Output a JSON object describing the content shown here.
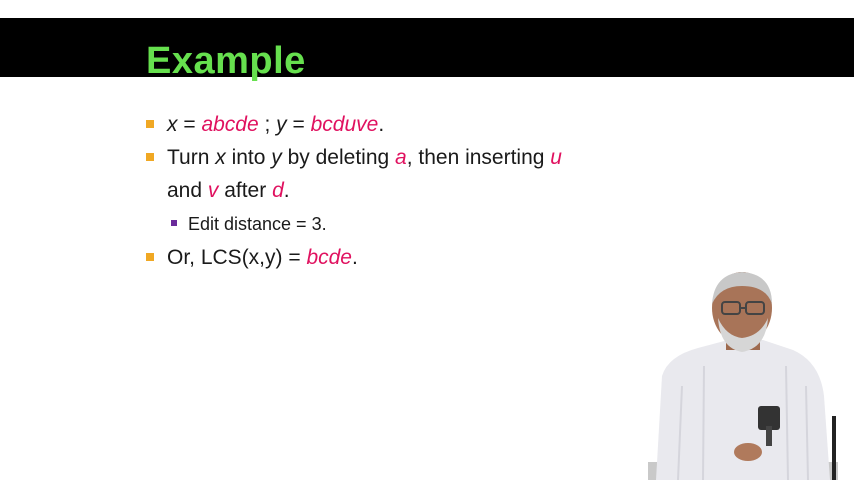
{
  "slide": {
    "title": "Example",
    "bullets": {
      "b1": {
        "x": "x",
        "eq1": " = ",
        "abcde": "abcde",
        "sep": " ; ",
        "y": "y",
        "eq2": " = ",
        "bcduve": "bcduve",
        "dot": "."
      },
      "b2": {
        "turn": "Turn ",
        "x": "x",
        "into": "  into ",
        "y": "y",
        "by": "  by deleting ",
        "a": "a",
        "then": ", then inserting ",
        "u": "u",
        "and": "and ",
        "v": "v",
        "after": "  after ",
        "d": "d",
        "dot": "."
      },
      "sub1": {
        "text": "Edit distance = 3."
      },
      "b3": {
        "prefix": "Or, LCS(x,y) = ",
        "bcde": "bcde",
        "dot": "."
      }
    }
  },
  "colors": {
    "title": "#66e04e",
    "accent": "#e0115f",
    "bullet": "#f0a824",
    "sub_bullet": "#6a2a9a"
  }
}
